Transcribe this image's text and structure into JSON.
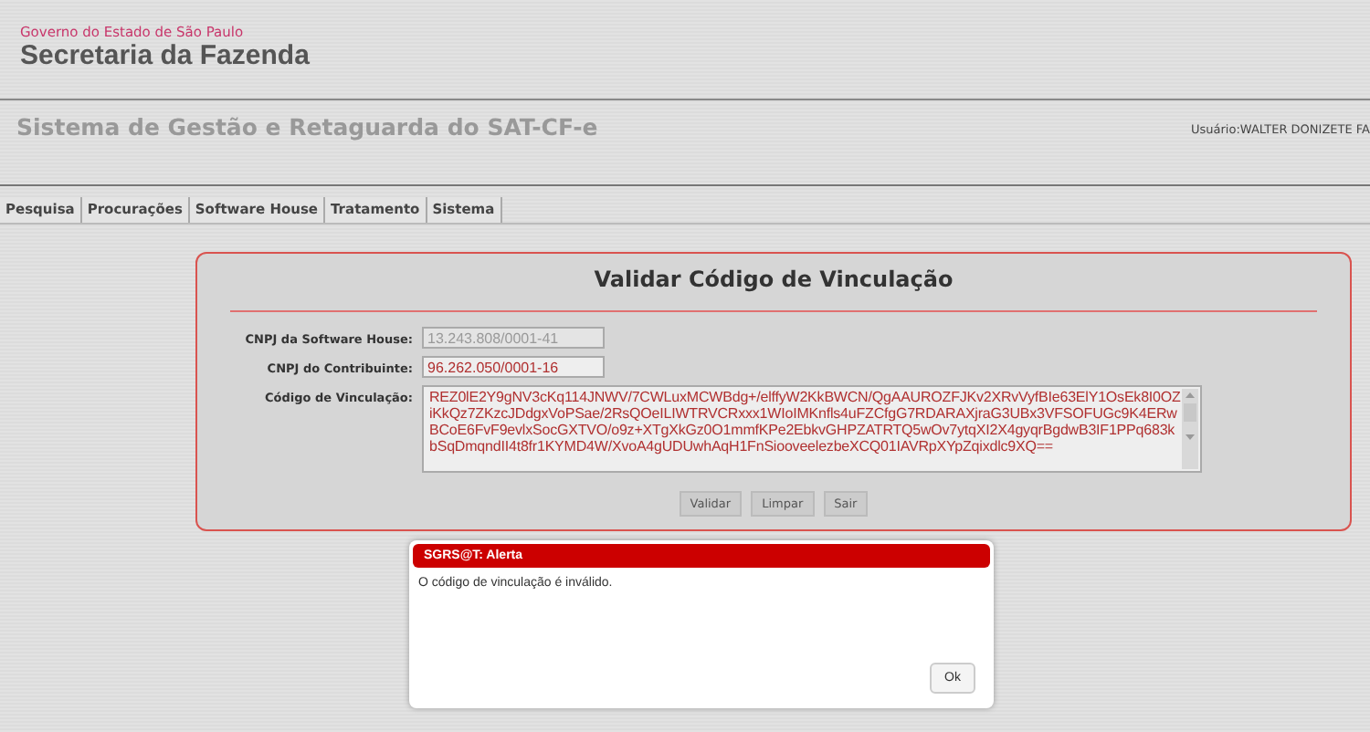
{
  "header": {
    "government": "Governo do Estado de São Paulo",
    "secretariat": "Secretaria da Fazenda"
  },
  "system": {
    "title": "Sistema de Gestão e Retaguarda do SAT-CF-e",
    "user": "Usuário:WALTER DONIZETE FA"
  },
  "menu": [
    {
      "label": "Pesquisa"
    },
    {
      "label": "Procurações"
    },
    {
      "label": "Software House"
    },
    {
      "label": "Tratamento"
    },
    {
      "label": "Sistema"
    }
  ],
  "form": {
    "title": "Validar Código de Vinculação",
    "fields": [
      {
        "label": "CNPJ da Software House:",
        "value": "13.243.808/0001-41",
        "disabled": true
      },
      {
        "label": "CNPJ do Contribuinte:",
        "value": "96.262.050/0001-16",
        "disabled": false
      }
    ],
    "code": {
      "label": "Código de Vinculação:",
      "value": "REZ0lE2Y9gNV3cKq114JNWV/7CWLuxMCWBdg+/elffyW2KkBWCN/QgAAUROZFJKv2XRvVyfBIe63ElY1OsEk8I0OZiKkQz7ZKzcJDdgxVoPSae/2RsQOeILIWTRVCRxxx1WIoIMKnfls4uFZCfgG7RDARAXjraG3UBx3VFSOFUGc9K4ERwBCoE6FvF9evlxSocGXTVO/o9z+XTgXkGz0O1mmfKPe2EbkvGHPZATRTQ5wOv7ytqXI2X4gyqrBgdwB3IF1PPq683kbSqDmqndII4t8fr1KYMD4W/XvoA4gUDUwhAqH1FnSiooveelezbeXCQ01IAVRpXYpZqixdlc9XQ=="
    },
    "buttons": [
      "Validar",
      "Limpar",
      "Sair"
    ]
  },
  "alert": {
    "title": "SGRS@T: Alerta",
    "message": "O código de vinculação é inválido.",
    "button": "Ok"
  }
}
